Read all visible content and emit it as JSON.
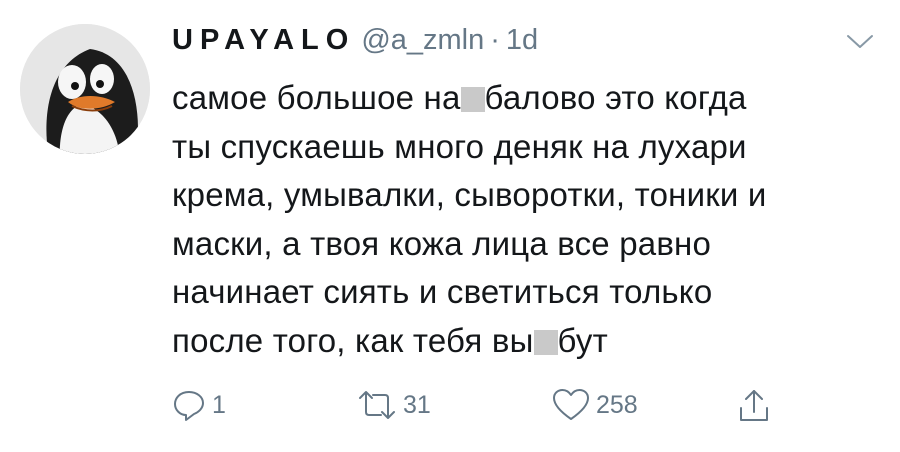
{
  "tweet": {
    "display_name": "UPAYALO",
    "handle": "@a_zmln",
    "separator": "·",
    "time": "1d",
    "lines": [
      {
        "before": "самое большое на",
        "after": "балово это когда"
      },
      {
        "text": "ты спускаешь много деняк на лухари"
      },
      {
        "text": "крема, умывалки, сыворотки, тоники и"
      },
      {
        "text": "маски, а твоя кожа лица все равно"
      },
      {
        "text": "начинает сиять и светиться только"
      },
      {
        "before": "после того, как тебя вы",
        "after": "бут"
      }
    ],
    "actions": {
      "reply_count": "1",
      "retweet_count": "31",
      "like_count": "258"
    }
  },
  "icons": {
    "avatar": "penguin-avatar",
    "caret": "chevron-down-icon",
    "reply": "reply-icon",
    "retweet": "retweet-icon",
    "like": "heart-icon",
    "share": "share-icon"
  },
  "colors": {
    "text": "#14171a",
    "secondary": "#657786",
    "censor": "#c9c9c9"
  }
}
